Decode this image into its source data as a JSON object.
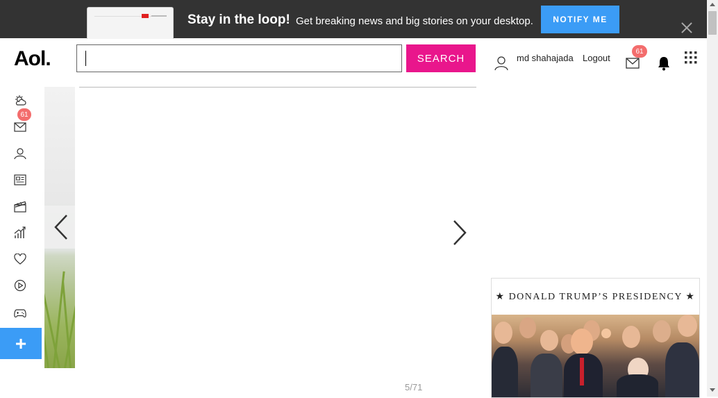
{
  "banner": {
    "title": "Stay in the loop!",
    "subtitle": "Get breaking news and big stories on your desktop.",
    "notify_label": "NOTIFY ME"
  },
  "header": {
    "logo": "Aol.",
    "search_placeholder": "",
    "search_label": "SEARCH",
    "username": "md shahajada",
    "logout_label": "Logout",
    "mail_count": "61"
  },
  "rail": {
    "mail_count": "61",
    "items": [
      "weather-icon",
      "mail-icon",
      "profile-icon",
      "news-icon",
      "entertainment-icon",
      "finance-icon",
      "lifestyle-icon",
      "video-icon",
      "games-icon"
    ],
    "plus_label": "+"
  },
  "gallery": {
    "counter": "5/71"
  },
  "sidebar": {
    "card_title": "★ DONALD TRUMP’S PRESIDENCY ★"
  },
  "colors": {
    "banner_bg": "#333333",
    "notify_blue": "#3b9cf6",
    "search_pink": "#e9168c",
    "badge_red": "#f36d6d"
  }
}
